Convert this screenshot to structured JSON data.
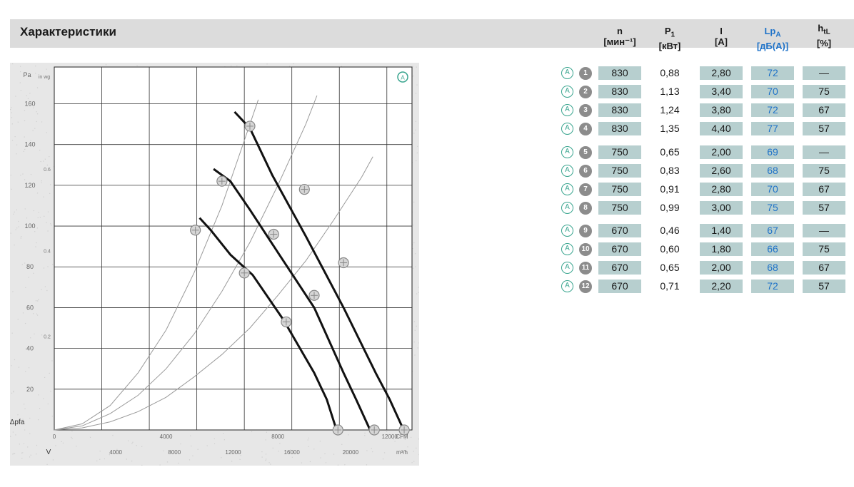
{
  "header": {
    "title": "Характеристики"
  },
  "table": {
    "columns": [
      {
        "label": "n",
        "unit": "[мин⁻¹]"
      },
      {
        "label": "P",
        "sub": "1",
        "unit": "[кВт]"
      },
      {
        "label": "I",
        "unit": "[A]"
      },
      {
        "label": "Lp",
        "sub": "A",
        "unit": "[дБ(А)]"
      },
      {
        "label": "h",
        "sub": "tL",
        "unit": "[%]"
      }
    ],
    "mark_letter": "A",
    "rows": [
      {
        "id": "1",
        "n": "830",
        "p1": "0,88",
        "i": "2,80",
        "lp": "72",
        "h": "—"
      },
      {
        "id": "2",
        "n": "830",
        "p1": "1,13",
        "i": "3,40",
        "lp": "70",
        "h": "75"
      },
      {
        "id": "3",
        "n": "830",
        "p1": "1,24",
        "i": "3,80",
        "lp": "72",
        "h": "67"
      },
      {
        "id": "4",
        "n": "830",
        "p1": "1,35",
        "i": "4,40",
        "lp": "77",
        "h": "57"
      },
      {
        "id": "5",
        "n": "750",
        "p1": "0,65",
        "i": "2,00",
        "lp": "69",
        "h": "—"
      },
      {
        "id": "6",
        "n": "750",
        "p1": "0,83",
        "i": "2,60",
        "lp": "68",
        "h": "75"
      },
      {
        "id": "7",
        "n": "750",
        "p1": "0,91",
        "i": "2,80",
        "lp": "70",
        "h": "67"
      },
      {
        "id": "8",
        "n": "750",
        "p1": "0,99",
        "i": "3,00",
        "lp": "75",
        "h": "57"
      },
      {
        "id": "9",
        "n": "670",
        "p1": "0,46",
        "i": "1,40",
        "lp": "67",
        "h": "—"
      },
      {
        "id": "10",
        "n": "670",
        "p1": "0,60",
        "i": "1,80",
        "lp": "66",
        "h": "75"
      },
      {
        "id": "11",
        "n": "670",
        "p1": "0,65",
        "i": "2,00",
        "lp": "68",
        "h": "67"
      },
      {
        "id": "12",
        "n": "670",
        "p1": "0,71",
        "i": "2,20",
        "lp": "72",
        "h": "57"
      }
    ]
  },
  "chart_data": {
    "type": "line",
    "marker_letter": "A",
    "y_axis": {
      "label": "Pa",
      "ylim": [
        0,
        160
      ],
      "ticks": [
        "20",
        "40",
        "60",
        "80",
        "100",
        "120",
        "140",
        "160"
      ],
      "secondary_label": "in wg",
      "secondary_ticks": [
        "0.2",
        "0.4",
        "0.6"
      ],
      "axis_symbol": "Δpfa"
    },
    "x_axis": {
      "xlim": [
        0,
        12800
      ],
      "cfm_label": "CFM",
      "cfm_ticks": [
        "0",
        "4000",
        "8000",
        "12000"
      ],
      "m3h_label": "m³/h",
      "m3h_ticks": [
        "4000",
        "8000",
        "12000",
        "16000",
        "20000"
      ],
      "flow_symbol": "V"
    },
    "grid": true,
    "series": [
      {
        "speed": "830",
        "x": [
          6450,
          7000,
          7800,
          9000,
          10350,
          11500,
          12000,
          12500
        ],
        "y": [
          156,
          148,
          125,
          95,
          60,
          28,
          15,
          0
        ]
      },
      {
        "speed": "750",
        "x": [
          5700,
          6300,
          7000,
          8100,
          9300,
          10350,
          10800,
          11300
        ],
        "y": [
          128,
          122,
          108,
          85,
          60,
          28,
          15,
          0
        ]
      },
      {
        "speed": "670",
        "x": [
          5200,
          5600,
          6300,
          7100,
          8200,
          9300,
          9750,
          10100
        ],
        "y": [
          104,
          98,
          86,
          76,
          54,
          28,
          15,
          0
        ]
      }
    ],
    "operating_points": [
      {
        "id": "1",
        "x": 12520,
        "y": 0
      },
      {
        "id": "2",
        "x": 10350,
        "y": 82
      },
      {
        "id": "3",
        "x": 8950,
        "y": 118
      },
      {
        "id": "4",
        "x": 7000,
        "y": 149
      },
      {
        "id": "5",
        "x": 11450,
        "y": 0
      },
      {
        "id": "6",
        "x": 9300,
        "y": 66
      },
      {
        "id": "7",
        "x": 7850,
        "y": 96
      },
      {
        "id": "8",
        "x": 6000,
        "y": 122
      },
      {
        "id": "9",
        "x": 10150,
        "y": 0
      },
      {
        "id": "10",
        "x": 8300,
        "y": 53
      },
      {
        "id": "11",
        "x": 6800,
        "y": 77
      },
      {
        "id": "12",
        "x": 5050,
        "y": 98
      }
    ],
    "system_curves": [
      {
        "x": [
          0,
          1000,
          2000,
          3000,
          4000,
          5000,
          6000,
          7000,
          7300
        ],
        "y": [
          0,
          3,
          12,
          28,
          49,
          77,
          110,
          150,
          162
        ]
      },
      {
        "x": [
          0,
          1000,
          2000,
          3000,
          4000,
          5000,
          6000,
          7000,
          8000,
          9000,
          9400
        ],
        "y": [
          0,
          2,
          8,
          17,
          30,
          47,
          68,
          92,
          120,
          150,
          164
        ]
      },
      {
        "x": [
          0,
          1000,
          2000,
          3000,
          4000,
          5000,
          6000,
          7000,
          8000,
          9000,
          10000,
          11000,
          11400
        ],
        "y": [
          0,
          1,
          4,
          9,
          16,
          26,
          37,
          50,
          66,
          83,
          103,
          124,
          134
        ]
      }
    ]
  }
}
